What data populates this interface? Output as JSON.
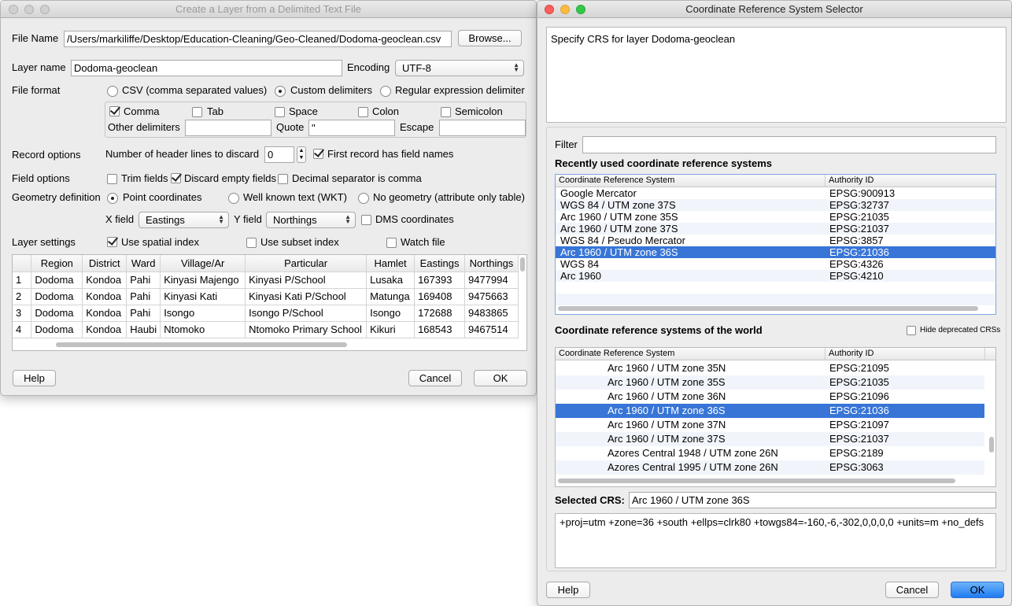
{
  "layer_dialog": {
    "title": "Create a Layer from a Delimited Text File",
    "file_name_label": "File Name",
    "file_name_value": "/Users/markiliffe/Desktop/Education-Cleaning/Geo-Cleaned/Dodoma-geoclean.csv",
    "browse_label": "Browse...",
    "layer_name_label": "Layer name",
    "layer_name_value": "Dodoma-geoclean",
    "encoding_label": "Encoding",
    "encoding_value": "UTF-8",
    "file_format_label": "File format",
    "format_csv": "CSV (comma separated values)",
    "format_custom": "Custom delimiters",
    "format_regex": "Regular expression delimiter",
    "delim_comma": "Comma",
    "delim_tab": "Tab",
    "delim_space": "Space",
    "delim_colon": "Colon",
    "delim_semicolon": "Semicolon",
    "other_delimiters_label": "Other delimiters",
    "other_delimiters_value": "",
    "quote_label": "Quote",
    "quote_value": "\"",
    "escape_label": "Escape",
    "escape_value": "",
    "record_options_label": "Record options",
    "header_lines_label": "Number of header lines to discard",
    "header_lines_value": "0",
    "first_record_label": "First record has field names",
    "field_options_label": "Field options",
    "trim_fields": "Trim fields",
    "discard_empty": "Discard empty fields",
    "decimal_comma": "Decimal separator is comma",
    "geometry_label": "Geometry definition",
    "geom_point": "Point coordinates",
    "geom_wkt": "Well known text (WKT)",
    "geom_none": "No geometry (attribute only table)",
    "x_field_label": "X field",
    "x_field_value": "Eastings",
    "y_field_label": "Y field",
    "y_field_value": "Northings",
    "dms_label": "DMS coordinates",
    "layer_settings_label": "Layer settings",
    "spatial_index": "Use spatial index",
    "subset_index": "Use subset index",
    "watch_file": "Watch file",
    "table_headers": [
      "",
      "Region",
      "District",
      "Ward",
      "Village/Ar",
      "Particular",
      "Hamlet",
      "Eastings",
      "Northings"
    ],
    "table_rows": [
      [
        "1",
        "Dodoma",
        "Kondoa",
        "Pahi",
        "Kinyasi Majengo",
        "Kinyasi P/School",
        "Lusaka",
        "167393",
        "9477994"
      ],
      [
        "2",
        "Dodoma",
        "Kondoa",
        "Pahi",
        "Kinyasi Kati",
        "Kinyasi Kati P/School",
        "Matunga",
        "169408",
        "9475663"
      ],
      [
        "3",
        "Dodoma",
        "Kondoa",
        "Pahi",
        "Isongo",
        "Isongo P/School",
        "Isongo",
        "172688",
        "9483865"
      ],
      [
        "4",
        "Dodoma",
        "Kondoa",
        "Haubi",
        "Ntomoko",
        "Ntomoko Primary School",
        "Kikuri",
        "168543",
        "9467514"
      ]
    ],
    "help_label": "Help",
    "cancel_label": "Cancel",
    "ok_label": "OK"
  },
  "crs_dialog": {
    "title": "Coordinate Reference System Selector",
    "message": "Specify CRS for layer Dodoma-geoclean",
    "filter_label": "Filter",
    "filter_value": "",
    "recent_heading": "Recently used coordinate reference systems",
    "col_crs": "Coordinate Reference System",
    "col_authority": "Authority ID",
    "recent_rows": [
      {
        "name": "Google Mercator",
        "id": "EPSG:900913"
      },
      {
        "name": "WGS 84 / UTM zone 37S",
        "id": "EPSG:32737"
      },
      {
        "name": "Arc 1960 / UTM zone 35S",
        "id": "EPSG:21035"
      },
      {
        "name": "Arc 1960 / UTM zone 37S",
        "id": "EPSG:21037"
      },
      {
        "name": "WGS 84 / Pseudo Mercator",
        "id": "EPSG:3857"
      },
      {
        "name": "Arc 1960 / UTM zone 36S",
        "id": "EPSG:21036"
      },
      {
        "name": "WGS 84",
        "id": "EPSG:4326"
      },
      {
        "name": "Arc 1960",
        "id": "EPSG:4210"
      }
    ],
    "world_heading": "Coordinate reference systems of the world",
    "hide_deprecated": "Hide deprecated CRSs",
    "world_rows": [
      {
        "name": "Arc 1960 / UTM zone 35N",
        "id": "EPSG:21095"
      },
      {
        "name": "Arc 1960 / UTM zone 35S",
        "id": "EPSG:21035"
      },
      {
        "name": "Arc 1960 / UTM zone 36N",
        "id": "EPSG:21096"
      },
      {
        "name": "Arc 1960 / UTM zone 36S",
        "id": "EPSG:21036"
      },
      {
        "name": "Arc 1960 / UTM zone 37N",
        "id": "EPSG:21097"
      },
      {
        "name": "Arc 1960 / UTM zone 37S",
        "id": "EPSG:21037"
      },
      {
        "name": "Azores Central 1948 / UTM zone 26N",
        "id": "EPSG:2189"
      },
      {
        "name": "Azores Central 1995 / UTM zone 26N",
        "id": "EPSG:3063"
      }
    ],
    "selected_label": "Selected CRS:",
    "selected_value": "Arc 1960 / UTM zone 36S",
    "proj_string": "+proj=utm +zone=36 +south +ellps=clrk80 +towgs84=-160,-6,-302,0,0,0,0 +units=m +no_defs",
    "help_label": "Help",
    "cancel_label": "Cancel",
    "ok_label": "OK"
  },
  "colors": {
    "selection": "#3875d7",
    "default_button": "#1f7cf2"
  }
}
